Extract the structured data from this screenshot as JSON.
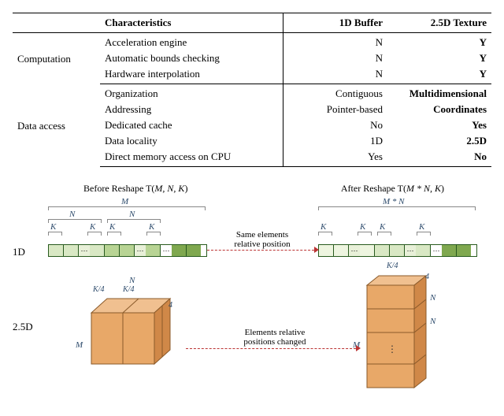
{
  "table": {
    "headers": {
      "c1": "",
      "c2": "Characteristics",
      "c3": "1D Buffer",
      "c4": "2.5D Texture"
    },
    "sections": [
      {
        "category": "Computation",
        "rows": [
          {
            "char": "Acceleration engine",
            "v1d": "N",
            "v25d": "Y"
          },
          {
            "char": "Automatic bounds checking",
            "v1d": "N",
            "v25d": "Y"
          },
          {
            "char": "Hardware interpolation",
            "v1d": "N",
            "v25d": "Y"
          }
        ]
      },
      {
        "category": "Data access",
        "rows": [
          {
            "char": "Organization",
            "v1d": "Contiguous",
            "v25d": "Multidimensional"
          },
          {
            "char": "Addressing",
            "v1d": "Pointer-based",
            "v25d": "Coordinates"
          },
          {
            "char": "Dedicated cache",
            "v1d": "No",
            "v25d": "Yes"
          },
          {
            "char": "Data locality",
            "v1d": "1D",
            "v25d": "2.5D"
          },
          {
            "char": "Direct memory access on CPU",
            "v1d": "Yes",
            "v25d": "No"
          }
        ]
      }
    ]
  },
  "diagram": {
    "before_title": "Before Reshape T(",
    "before_args": "M, N, K",
    "after_title": "After Reshape T(",
    "after_args": "M * N, K",
    "close_paren": ")",
    "row_labels": {
      "d1": "1D",
      "d25": "2.5D"
    },
    "dims": {
      "M": "M",
      "N": "N",
      "K": "K",
      "MN": "M * N",
      "Kover4": "K",
      "four": "4"
    },
    "arrows": {
      "a1": "Same elements\nrelative position",
      "a2": "Elements relative\npositions changed"
    },
    "ellipsis": "⋯"
  }
}
